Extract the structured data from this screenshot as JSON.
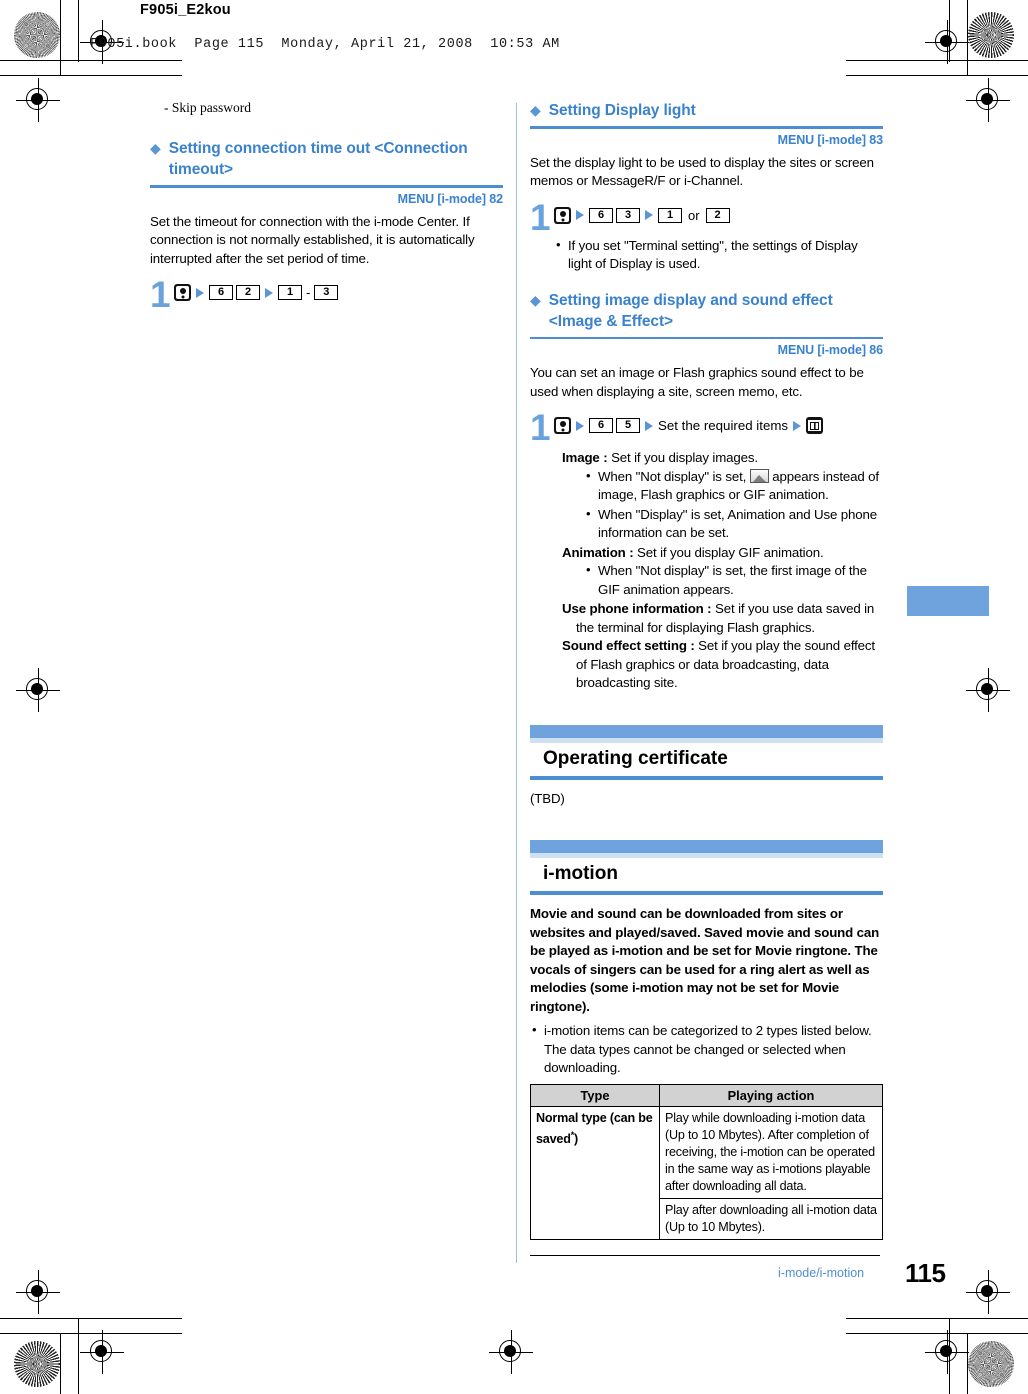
{
  "page": {
    "file_tag": "F905i_E2kou",
    "book_line": "F905i.book  Page 115  Monday, April 21, 2008  10:53 AM",
    "folio": "115",
    "footer_label": "i-mode/i-motion",
    "accent_blue": "#4d8ed2",
    "header_bar_blue": "#6fa3dd",
    "heading_blue": "#3a82cd"
  },
  "left_column": {
    "subnote": "- Skip password",
    "topic": {
      "diamond": "diamond-icon",
      "title": "Setting connection time out <Connection timeout>",
      "menu_ref": "MENU [i-mode] 82",
      "intro": "Set the timeout for connection with the i-mode Center. If connection is not normally established, it is automatically interrupted after the set period of time.",
      "step": {
        "number": "1",
        "keys": {
          "imode_key": "imode-key-icon",
          "arrow1": "arrow-right-icon",
          "k6": "6",
          "k2": "2",
          "arrow2": "arrow-right-icon",
          "k1": "1",
          "dash": "-",
          "k3": "3"
        }
      }
    }
  },
  "right_column": {
    "topic_display_light": {
      "title": "Setting Display light",
      "menu_ref": "MENU [i-mode] 83",
      "intro": "Set the display light to be used to display the sites or screen memos or MessageR/F or i-Channel.",
      "step": {
        "number": "1",
        "keys": {
          "imode_key": "imode-key-icon",
          "k6": "6",
          "k3": "3",
          "k1": "1",
          "or": "or",
          "k2": "2"
        },
        "bullets": [
          "If you set \"Terminal setting\", the settings of Display light of Display is used."
        ]
      }
    },
    "topic_image_effect": {
      "title": "Setting image display and sound effect <Image & Effect>",
      "menu_ref": "MENU [i-mode] 86",
      "intro": "You can set an image or Flash graphics sound effect to be used when displaying a site, screen memo, etc.",
      "step": {
        "number": "1",
        "keys": {
          "imode_key": "imode-key-icon",
          "k6": "6",
          "k5": "5",
          "middle_text": "Set the required items",
          "book_key": "book-key-icon"
        },
        "definitions": [
          {
            "term": "Image :",
            "desc": "Set if you display images.",
            "bullets": [
              "When \"Not display\" is set, [image-placeholder-icon] appears instead of image, Flash graphics or GIF animation.",
              "When \"Display\" is set, Animation and Use phone information can be set."
            ]
          },
          {
            "term": "Animation :",
            "desc": "Set if you display GIF animation.",
            "bullets": [
              "When \"Not display\" is set, the first image of the GIF animation appears."
            ]
          },
          {
            "term": "Use phone information :",
            "desc": "Set if you use data saved in the terminal for displaying Flash graphics.",
            "bullets": []
          },
          {
            "term": "Sound effect setting :",
            "desc": "Set if you play the sound effect of Flash graphics or data broadcasting, data broadcasting site.",
            "bullets": []
          }
        ]
      }
    },
    "section_operating_certificate": {
      "title": "Operating certificate",
      "body": "(TBD)"
    },
    "section_imotion": {
      "title": "i-motion",
      "intro": "Movie and sound can be downloaded from sites or websites and played/saved. Saved movie and sound can be played as i-motion and be set for Movie ringtone. The vocals of singers can be used for a ring alert as well as melodies (some i-motion may not be set for Movie ringtone).",
      "bullets": [
        "i-motion items can be categorized to 2 types listed below. The data types cannot be changed or selected when downloading."
      ],
      "table": {
        "headers": [
          "Type",
          "Playing action"
        ],
        "rows": [
          {
            "type": "Normal type (can be saved",
            "type_sup": "*",
            "type_tail": ")",
            "action": "Play while downloading i-motion data (Up to 10 Mbytes). After completion of receiving, the i-motion can be operated in the same way as i-motions playable after downloading all data."
          },
          {
            "type": "",
            "type_sup": "",
            "type_tail": "",
            "action": "Play after downloading all i-motion data (Up to 10 Mbytes)."
          }
        ]
      }
    }
  }
}
